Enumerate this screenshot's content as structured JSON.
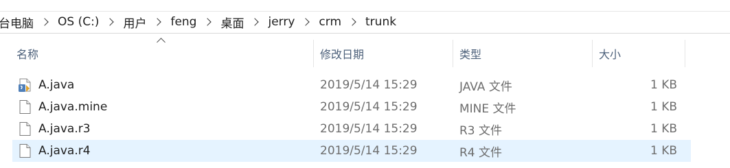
{
  "breadcrumb": [
    "台电脑",
    "OS (C:)",
    "用户",
    "feng",
    "桌面",
    "jerry",
    "crm",
    "trunk"
  ],
  "columns": {
    "name": "名称",
    "date": "修改日期",
    "type": "类型",
    "size": "大小"
  },
  "files": [
    {
      "name": "A.java",
      "date": "2019/5/14 15:29",
      "type": "JAVA 文件",
      "size": "1 KB",
      "icon": "java-file-icon"
    },
    {
      "name": "A.java.mine",
      "date": "2019/5/14 15:29",
      "type": "MINE 文件",
      "size": "1 KB",
      "icon": "file-icon"
    },
    {
      "name": "A.java.r3",
      "date": "2019/5/14 15:29",
      "type": "R3 文件",
      "size": "1 KB",
      "icon": "file-icon"
    },
    {
      "name": "A.java.r4",
      "date": "2019/5/14 15:29",
      "type": "R4 文件",
      "size": "1 KB",
      "icon": "file-icon",
      "selected": true
    }
  ],
  "colors": {
    "selection": "#e5f3ff",
    "header_text": "#4c607a",
    "meta_text": "#6d6d6d"
  }
}
